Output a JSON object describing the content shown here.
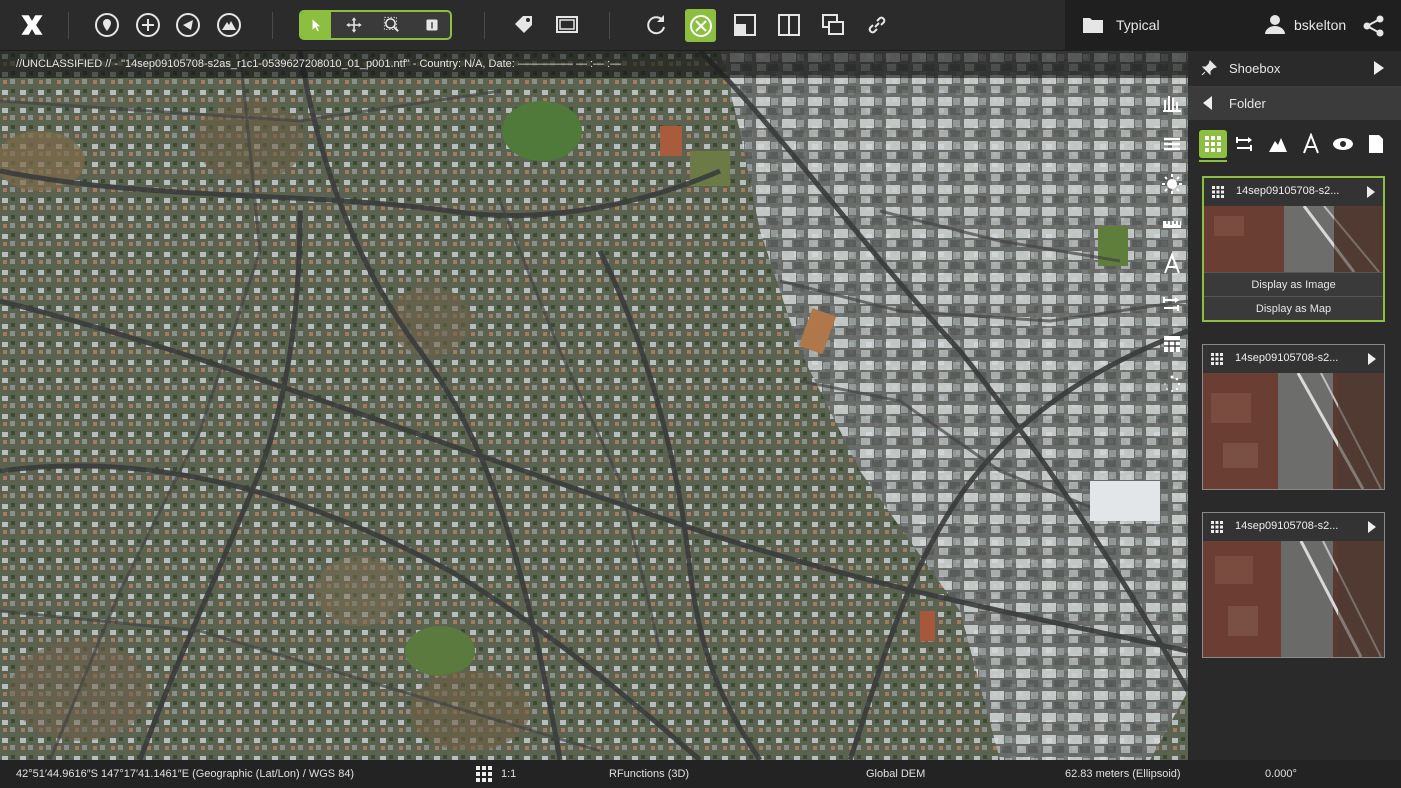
{
  "toolbar": {
    "logo": "X",
    "tools": [
      {
        "name": "placemark-icon"
      },
      {
        "name": "add-icon"
      },
      {
        "name": "navigate-icon"
      },
      {
        "name": "terrain-icon"
      }
    ],
    "select_group": [
      "select-arrow-icon",
      "pan-icon",
      "zoom-region-icon",
      "info-icon"
    ],
    "other_tools": [
      "tag-icon",
      "screen-icon",
      "refresh-icon",
      "crosshair-icon",
      "single-view-icon",
      "split-view-icon",
      "overlay-view-icon",
      "link-icon"
    ]
  },
  "user_area": {
    "workspace": "Typical",
    "username": "bskelton"
  },
  "map": {
    "classification_banner": "//UNCLASSIFIED // - \"14sep09105708-s2as_r1c1-0539627208010_01_p001.ntf\" - Country: N/A, Date: ————— — :— :—"
  },
  "panel": {
    "shoebox_label": "Shoebox",
    "folder_label": "Folder",
    "cards": [
      {
        "title": "14sep09105708-s2...",
        "buttons": [
          "Display as Image",
          "Display as Map"
        ]
      },
      {
        "title": "14sep09105708-s2..."
      },
      {
        "title": "14sep09105708-s2..."
      }
    ]
  },
  "status": {
    "coordinates": "42°51′44.9616″S 147°17′41.1461″E (Geographic (Lat/Lon) / WGS 84)",
    "scale": "1:1",
    "functions": "RFunctions (3D)",
    "dem": "Global DEM",
    "elevation": "62.83 meters (Ellipsoid)",
    "rotation": "0.000°"
  },
  "colors": {
    "accent": "#8cbf3f",
    "toolbar_bg": "#2b2b2b",
    "panel_bg": "#2a2a2a",
    "status_bg": "#232323"
  }
}
